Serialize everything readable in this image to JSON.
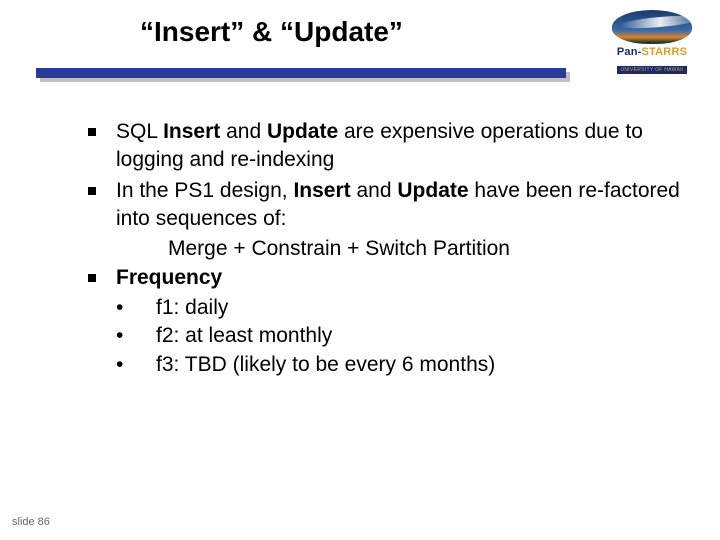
{
  "title": "“Insert” & “Update”",
  "logo": {
    "brand_pre": "Pan-",
    "brand_star": "STARRS",
    "sub": "UNIVERSITY OF HAWAII"
  },
  "bullets": {
    "b1_a": "SQL ",
    "b1_b": "Insert",
    "b1_c": " and ",
    "b1_d": "Update",
    "b1_e": " are expensive operations due to  logging and re-indexing",
    "b2_a": "In the PS1 design, ",
    "b2_b": "Insert",
    "b2_c": " and ",
    "b2_d": "Update",
    "b2_e": " have been re-factored into sequences of:",
    "b2_sub": "Merge + Constrain + Switch Partition",
    "b3": "Frequency",
    "b3_s1": "f1: daily",
    "b3_s2": "f2: at least monthly",
    "b3_s3": "f3: TBD (likely to be every 6 months)"
  },
  "footer": "slide 86"
}
